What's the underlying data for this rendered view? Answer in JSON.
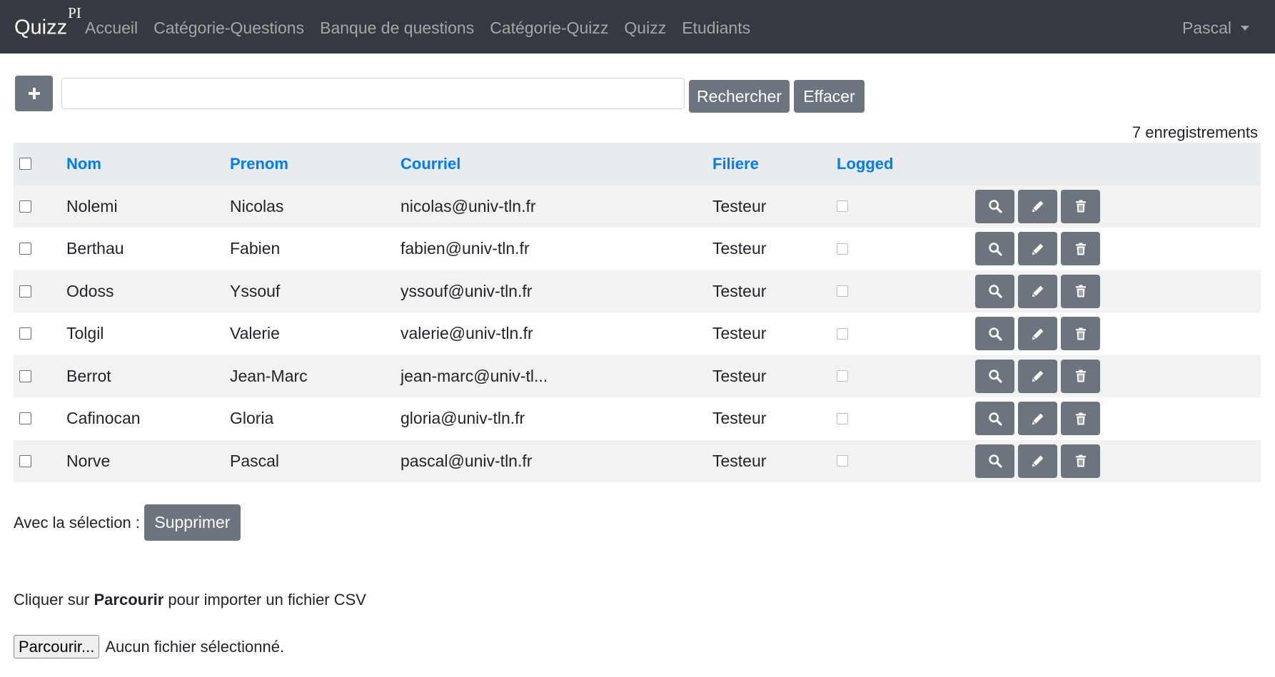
{
  "navbar": {
    "brand": "Quizz",
    "brand_sup": "PI",
    "links": [
      "Accueil",
      "Catégorie-Questions",
      "Banque de questions",
      "Catégorie-Quizz",
      "Quizz",
      "Etudiants"
    ],
    "user": "Pascal",
    "bg_color": "#343a40"
  },
  "toolbar": {
    "add_icon": "plus-icon",
    "search_value": "",
    "search_label": "Rechercher",
    "clear_label": "Effacer"
  },
  "record_count": "7 enregistrements",
  "table": {
    "headers": [
      "Nom",
      "Prenom",
      "Courriel",
      "Filiere",
      "Logged"
    ],
    "header_color": "#007bff",
    "rows": [
      {
        "nom": "Nolemi",
        "prenom": "Nicolas",
        "courriel": "nicolas@univ-tln.fr",
        "filiere": "Testeur",
        "logged": false
      },
      {
        "nom": "Berthau",
        "prenom": "Fabien",
        "courriel": "fabien@univ-tln.fr",
        "filiere": "Testeur",
        "logged": false
      },
      {
        "nom": "Odoss",
        "prenom": "Yssouf",
        "courriel": "yssouf@univ-tln.fr",
        "filiere": "Testeur",
        "logged": false
      },
      {
        "nom": "Tolgil",
        "prenom": "Valerie",
        "courriel": "valerie@univ-tln.fr",
        "filiere": "Testeur",
        "logged": false
      },
      {
        "nom": "Berrot",
        "prenom": "Jean-Marc",
        "courriel": "jean-marc@univ-tl...",
        "filiere": "Testeur",
        "logged": false
      },
      {
        "nom": "Cafinocan",
        "prenom": "Gloria",
        "courriel": "gloria@univ-tln.fr",
        "filiere": "Testeur",
        "logged": false
      },
      {
        "nom": "Norve",
        "prenom": "Pascal",
        "courriel": "pascal@univ-tln.fr",
        "filiere": "Testeur",
        "logged": false
      }
    ],
    "action_icons": [
      "search-icon",
      "pencil-icon",
      "trash-icon"
    ]
  },
  "bulk": {
    "label": "Avec la sélection :",
    "delete_label": "Supprimer"
  },
  "import": {
    "text_before": "Cliquer sur ",
    "text_bold": "Parcourir",
    "text_after": " pour importer un fichier CSV",
    "browse_label": "Parcourir...",
    "file_status": "Aucun fichier sélectionné."
  },
  "colors": {
    "button": "#6c757d",
    "row_striped": "#f2f2f2",
    "header_row": "#e9ecef"
  }
}
